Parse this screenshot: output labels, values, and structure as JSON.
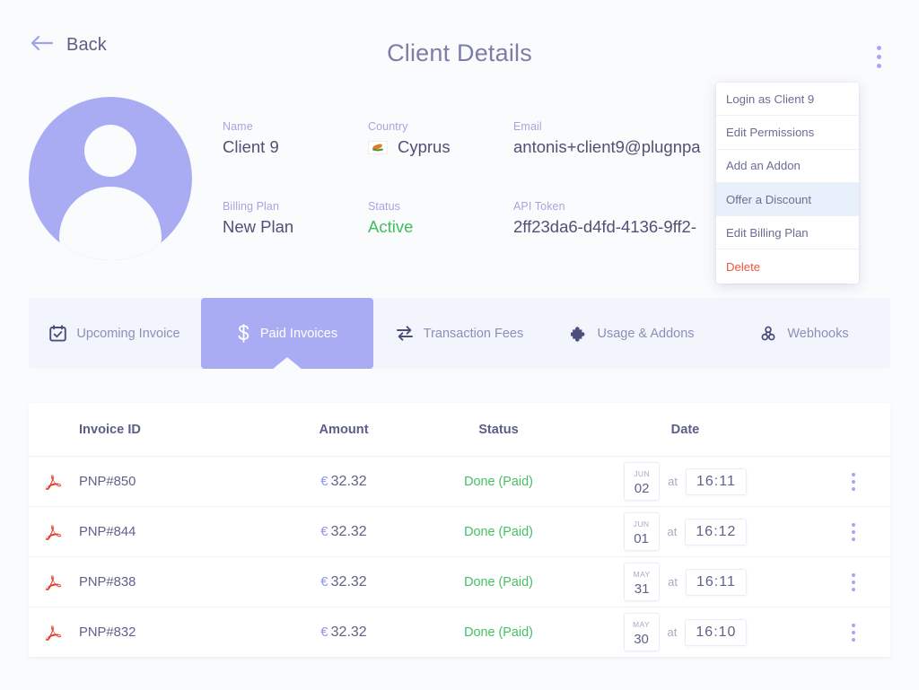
{
  "header": {
    "back_label": "Back",
    "title": "Client Details",
    "back_icon": "arrow-left-icon",
    "kebab_icon": "vertical-dots-icon"
  },
  "menu": {
    "items": [
      {
        "label": "Login as Client 9",
        "state": "normal"
      },
      {
        "label": "Edit Permissions",
        "state": "normal"
      },
      {
        "label": "Add an Addon",
        "state": "normal"
      },
      {
        "label": "Offer a Discount",
        "state": "hover"
      },
      {
        "label": "Edit Billing Plan",
        "state": "normal"
      },
      {
        "label": "Delete",
        "state": "danger"
      }
    ]
  },
  "client": {
    "avatar_icon": "user-avatar-icon",
    "row1": [
      {
        "label": "Name",
        "value": "Client 9"
      },
      {
        "label": "Country",
        "value": "Cyprus",
        "flag": "cyprus-flag-icon"
      },
      {
        "label": "Email",
        "value": "antonis+client9@plugnpa"
      }
    ],
    "row2": [
      {
        "label": "Billing Plan",
        "value": "New Plan"
      },
      {
        "label": "Status",
        "value": "Active"
      },
      {
        "label": "API Token",
        "value": "2ff23da6-d4fd-4136-9ff2-"
      }
    ]
  },
  "tabs": [
    {
      "label": "Upcoming Invoice",
      "icon": "calendar-check-icon",
      "active": false
    },
    {
      "label": "Paid Invoices",
      "icon": "dollar-icon",
      "active": true
    },
    {
      "label": "Transaction Fees",
      "icon": "exchange-arrows-icon",
      "active": false
    },
    {
      "label": "Usage & Addons",
      "icon": "puzzle-piece-icon",
      "active": false
    },
    {
      "label": "Webhooks",
      "icon": "webhook-icon",
      "active": false
    }
  ],
  "table": {
    "columns": [
      "",
      "Invoice ID",
      "Amount",
      "Status",
      "Date",
      ""
    ],
    "rows": [
      {
        "icon": "pdf-icon",
        "invoice_id": "PNP#850",
        "currency": "€",
        "amount": "32.32",
        "status": "Done (Paid)",
        "month": "JUN",
        "day": "02",
        "at": "at",
        "time": "16:11",
        "menu_icon": "vertical-dots-icon"
      },
      {
        "icon": "pdf-icon",
        "invoice_id": "PNP#844",
        "currency": "€",
        "amount": "32.32",
        "status": "Done (Paid)",
        "month": "JUN",
        "day": "01",
        "at": "at",
        "time": "16:12",
        "menu_icon": "vertical-dots-icon"
      },
      {
        "icon": "pdf-icon",
        "invoice_id": "PNP#838",
        "currency": "€",
        "amount": "32.32",
        "status": "Done (Paid)",
        "month": "MAY",
        "day": "31",
        "at": "at",
        "time": "16:11",
        "menu_icon": "vertical-dots-icon"
      },
      {
        "icon": "pdf-icon",
        "invoice_id": "PNP#832",
        "currency": "€",
        "amount": "32.32",
        "status": "Done (Paid)",
        "month": "MAY",
        "day": "30",
        "at": "at",
        "time": "16:10",
        "menu_icon": "vertical-dots-icon"
      }
    ]
  },
  "colors": {
    "accent_purple": "#a9abf3",
    "page_bg": "#fafbfd",
    "text_muted": "#8c90b5",
    "success_green": "#46bf63",
    "danger_red": "#f0563b",
    "menu_hover": "#e8f1fb"
  }
}
